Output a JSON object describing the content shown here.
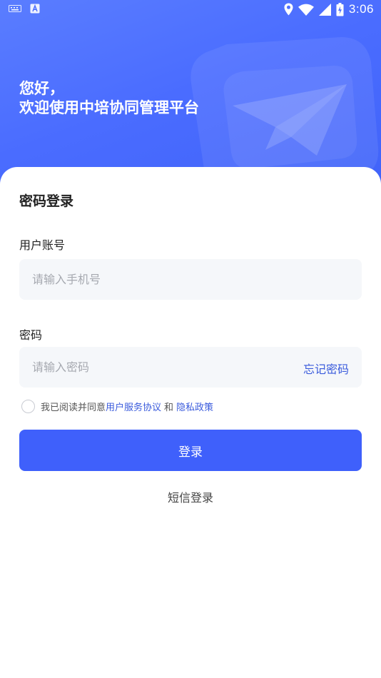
{
  "status_bar": {
    "time": "3:06",
    "left_icons": [
      "keyboard-icon",
      "a-box-icon"
    ],
    "right_icons": [
      "location-icon",
      "wifi-icon",
      "signal-icon",
      "battery-icon"
    ]
  },
  "hero": {
    "greeting_line1": "您好，",
    "greeting_line2": "欢迎使用中培协同管理平台",
    "background_color": "#4a6cff",
    "logo_icon": "paper-plane-shield-logo"
  },
  "login": {
    "title": "密码登录",
    "account": {
      "label": "用户账号",
      "value": "",
      "placeholder": "请输入手机号"
    },
    "password": {
      "label": "密码",
      "value": "",
      "placeholder": "请输入密码",
      "forgot_label": "忘记密码"
    },
    "agreement": {
      "prefix": "我已阅读并同意",
      "terms_label": "用户服务协议",
      "and": "和",
      "privacy_label": "隐私政策",
      "checked": false
    },
    "submit_label": "登录",
    "sms_login_label": "短信登录",
    "accent_color": "#3f60fb",
    "link_color": "#3a5bdc"
  }
}
